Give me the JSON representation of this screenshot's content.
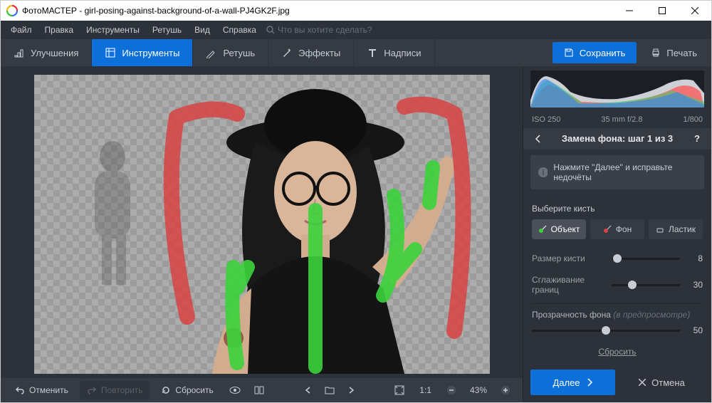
{
  "window": {
    "title": "ФотоМАСТЕР - girl-posing-against-background-of-a-wall-PJ4GK2F.jpg"
  },
  "menu": {
    "file": "Файл",
    "edit": "Правка",
    "tools": "Инструменты",
    "retouch": "Ретушь",
    "view": "Вид",
    "help": "Справка",
    "search_placeholder": "Что вы хотите сделать?"
  },
  "tabs": {
    "improve": "Улучшения",
    "tools": "Инструменты",
    "retouch": "Ретушь",
    "effects": "Эффекты",
    "captions": "Надписи"
  },
  "actions": {
    "save": "Сохранить",
    "print": "Печать"
  },
  "bottom": {
    "undo": "Отменить",
    "redo": "Повторить",
    "reset": "Сбросить",
    "zoom_ratio": "1:1",
    "zoom_pct": "43%"
  },
  "histogram": {
    "iso": "ISO 250",
    "focal": "35 mm f/2.8",
    "shutter": "1/800"
  },
  "panel": {
    "title": "Замена фона: шаг 1 из 3",
    "hint": "Нажмите \"Далее\" и исправьте недочёты",
    "select_brush": "Выберите кисть",
    "brush_object": "Объект",
    "brush_bg": "Фон",
    "brush_eraser": "Ластик",
    "brush_size": "Размер кисти",
    "brush_size_val": "8",
    "smoothing": "Сглаживание границ",
    "smoothing_val": "30",
    "opacity_label": "Прозрачность фона",
    "opacity_hint": "(в предпросмотре)",
    "opacity_val": "50",
    "reset": "Сбросить",
    "next": "Далее",
    "cancel": "Отмена"
  }
}
